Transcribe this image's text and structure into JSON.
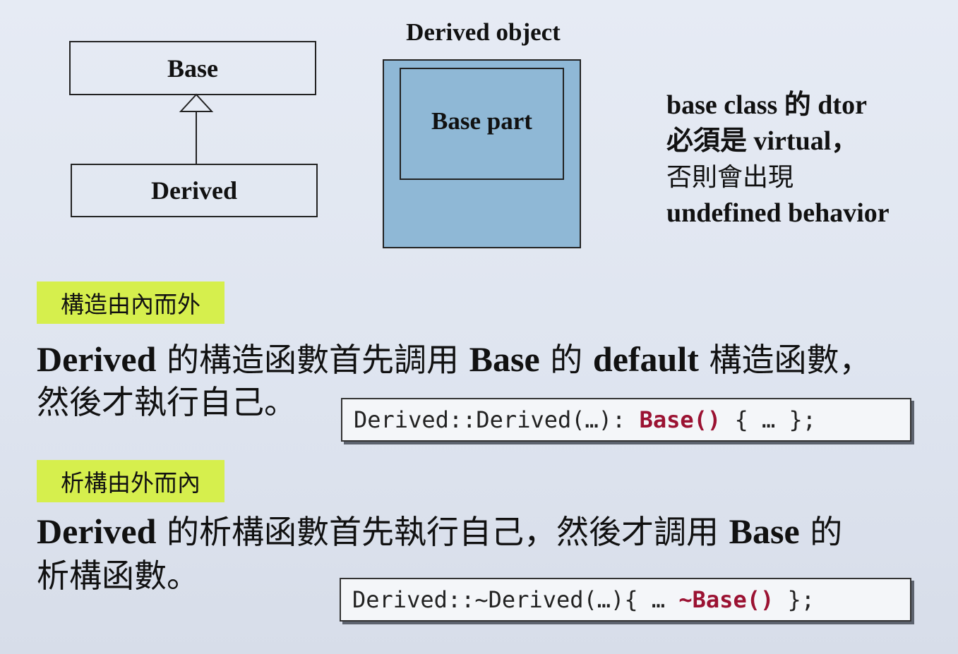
{
  "uml": {
    "base_label": "Base",
    "derived_label": "Derived"
  },
  "object_diagram": {
    "title": "Derived object",
    "inner_label": "Base part"
  },
  "note": {
    "line1": "base class 的 dtor",
    "line2": "必須是 virtual，",
    "line3": "否則會出現",
    "line4": "undefined behavior"
  },
  "construction": {
    "tag": "構造由內而外",
    "line1_a": "Derived",
    "line1_b": " 的構造函數首先調用 ",
    "line1_c": "Base",
    "line1_d": " 的 ",
    "line1_e": "default",
    "line1_f": " 構造函數，",
    "line2": "然後才執行自己。",
    "code_pre": "Derived::Derived(…): ",
    "code_hl": "Base()",
    "code_post": " { … };"
  },
  "destruction": {
    "tag": "析構由外而內",
    "line1_a": "Derived",
    "line1_b": " 的析構函數首先執行自己，然後才調用 ",
    "line1_c": "Base",
    "line1_d": " 的",
    "line2": "析構函數。",
    "code_pre": "Derived::~Derived(…){ … ",
    "code_hl": "~Base()",
    "code_post": " };"
  },
  "colors": {
    "tag_bg": "#d6ef4d",
    "object_fill": "#8fb8d6",
    "code_highlight": "#9b1232"
  }
}
